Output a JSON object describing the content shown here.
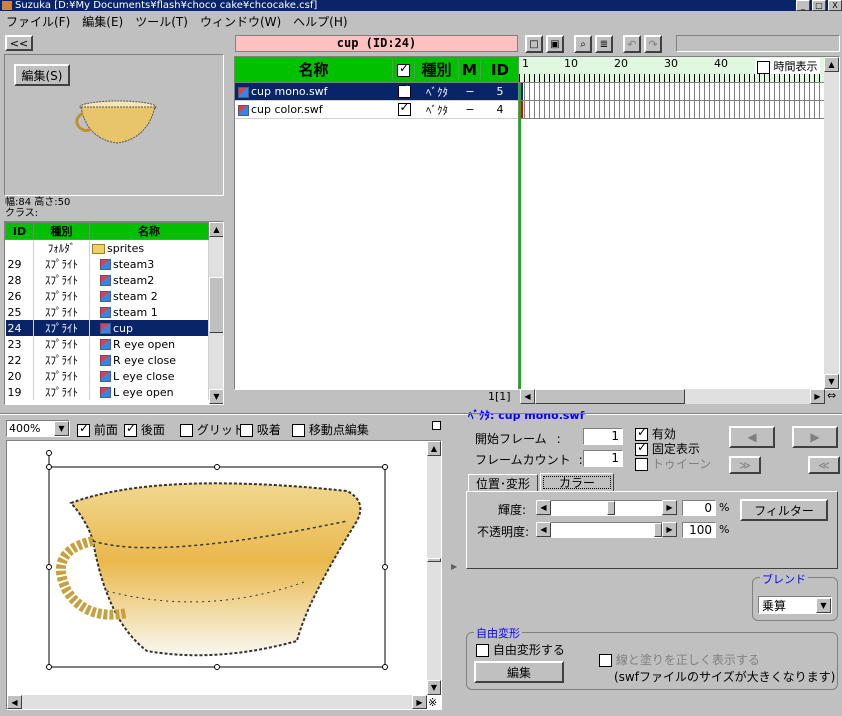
{
  "window": {
    "title": "Suzuka [D:¥My Documents¥flash¥choco cake¥chcocake.csf]",
    "min": "_",
    "max": "□",
    "close": "X"
  },
  "menu": [
    "ファイル(F)",
    "編集(E)",
    "ツール(T)",
    "ウィンドウ(W)",
    "ヘルプ(H)"
  ],
  "left": {
    "collapse_btn": "<<",
    "edit_btn": "編集(S)",
    "size_text": "幅:84 高さ:50",
    "class_text": "クラス:",
    "table_headers": [
      "ID",
      "種別",
      "名称"
    ],
    "rows": [
      {
        "id": "",
        "type": "ﾌｫﾙﾀﾞ",
        "name": "sprites",
        "kind": "folder"
      },
      {
        "id": "29",
        "type": "ｽﾌﾟﾗｲﾄ",
        "name": "steam3",
        "kind": "sprite"
      },
      {
        "id": "28",
        "type": "ｽﾌﾟﾗｲﾄ",
        "name": "steam2",
        "kind": "sprite"
      },
      {
        "id": "26",
        "type": "ｽﾌﾟﾗｲﾄ",
        "name": "steam 2",
        "kind": "sprite"
      },
      {
        "id": "25",
        "type": "ｽﾌﾟﾗｲﾄ",
        "name": "steam 1",
        "kind": "sprite"
      },
      {
        "id": "24",
        "type": "ｽﾌﾟﾗｲﾄ",
        "name": "cup",
        "kind": "sprite",
        "selected": true
      },
      {
        "id": "23",
        "type": "ｽﾌﾟﾗｲﾄ",
        "name": "R eye open",
        "kind": "sprite"
      },
      {
        "id": "22",
        "type": "ｽﾌﾟﾗｲﾄ",
        "name": "R eye close",
        "kind": "sprite"
      },
      {
        "id": "20",
        "type": "ｽﾌﾟﾗｲﾄ",
        "name": "L eye close",
        "kind": "sprite"
      },
      {
        "id": "19",
        "type": "ｽﾌﾟﾗｲﾄ",
        "name": "L eye open",
        "kind": "sprite"
      }
    ]
  },
  "center": {
    "title": "cup (ID:24)",
    "headers": {
      "name": "名称",
      "type": "種別",
      "m": "M",
      "id": "ID"
    },
    "layers": [
      {
        "name": "cup mono.swf",
        "type": "ﾍﾞｸﾀ",
        "m": "−",
        "id": "5",
        "checked": true,
        "selected": true
      },
      {
        "name": "cup color.swf",
        "type": "ﾍﾞｸﾀ",
        "m": "−",
        "id": "4",
        "checked": true,
        "selected": false
      }
    ],
    "frame_counter": "1[1]"
  },
  "timeline": {
    "ticks": [
      "1",
      "10",
      "20",
      "30",
      "40"
    ],
    "time_display": "時間表示"
  },
  "toolbar_icons": [
    "new-doc-icon",
    "save-icon",
    "zoom-icon",
    "list-icon",
    "undo-icon",
    "redo-icon"
  ],
  "stage": {
    "zoom": "400%",
    "front": "前面",
    "back": "後面",
    "grid": "グリッド",
    "snap": "吸着",
    "move_point": "移動点編集"
  },
  "props": {
    "header": "ﾍﾞｸﾀ: cup mono.swf",
    "start_frame_label": "開始フレーム",
    "start_frame_value": "1",
    "frame_count_label": "フレームカウント",
    "frame_count_value": "1",
    "enabled": "有効",
    "fixed_display": "固定表示",
    "tween": "トゥイーン",
    "tab_position": "位置･変形",
    "tab_color": "カラー",
    "brightness_label": "輝度:",
    "brightness_value": "0",
    "opacity_label": "不透明度:",
    "opacity_value": "100",
    "percent": "%",
    "filter_btn": "フィルター",
    "blend_group": "ブレンド",
    "blend_value": "乗算",
    "free_group": "自由変形",
    "free_check": "自由変形する",
    "edit_btn": "編集",
    "line_check": "線と塗りを正しく表示する",
    "line_note": "(swfファイルのサイズが大きくなります)",
    "btn_prev": "◀",
    "btn_next": "▶",
    "btn_ff": "≫",
    "btn_rw": "≪"
  },
  "colors": {
    "title_bg": "#0a246a",
    "green": "#00c000",
    "selected": "#0a246a",
    "pink": "#ffc0c0"
  }
}
